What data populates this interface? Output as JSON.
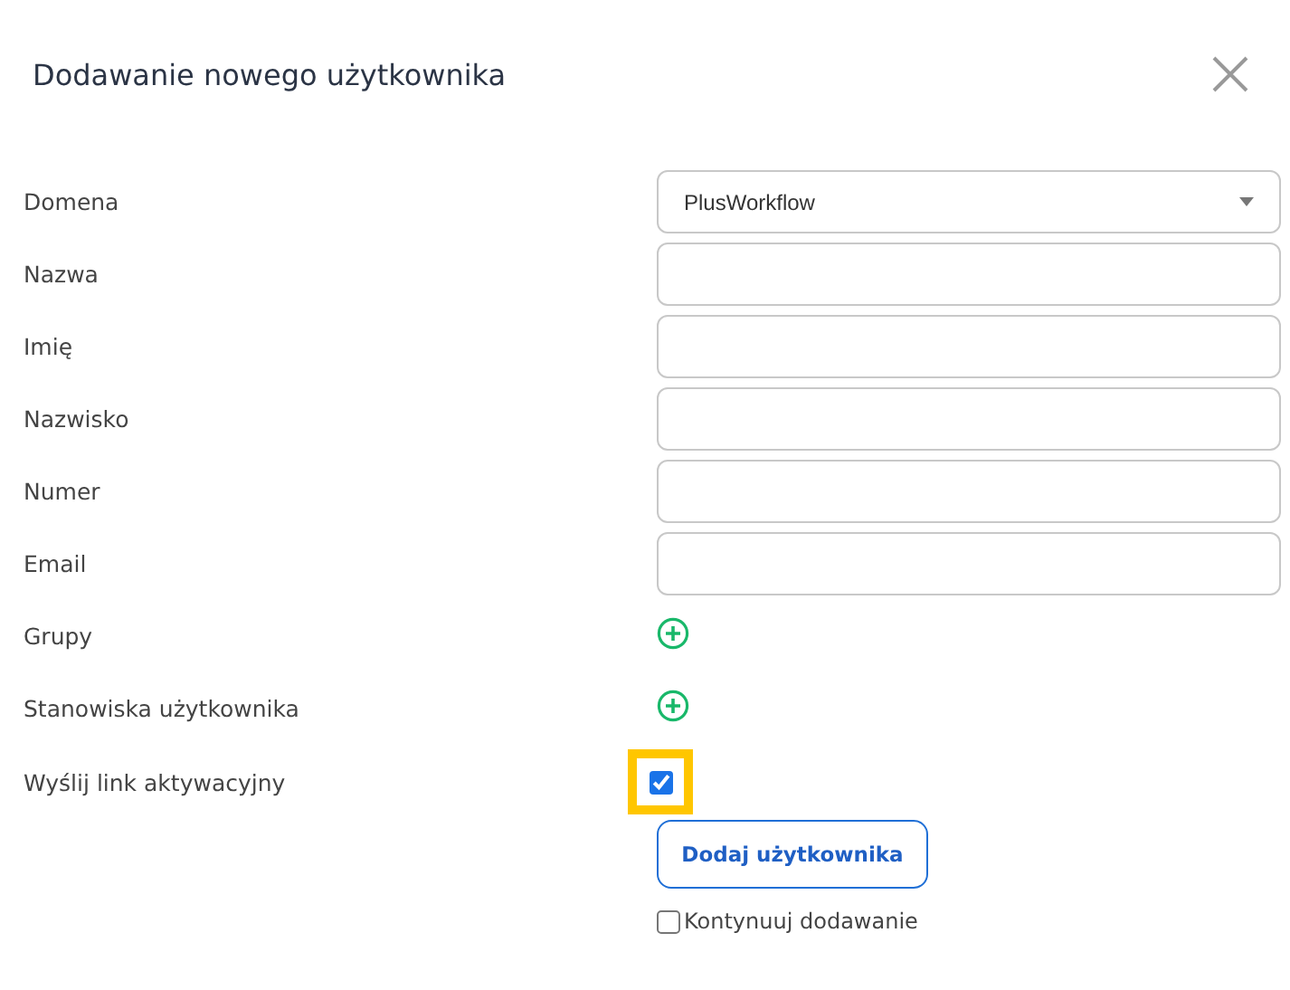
{
  "dialog": {
    "title": "Dodawanie nowego użytkownika"
  },
  "fields": [
    {
      "kind": "select",
      "label": "Domena",
      "value": "PlusWorkflow"
    },
    {
      "kind": "text",
      "label": "Nazwa"
    },
    {
      "kind": "text",
      "label": "Imię"
    },
    {
      "kind": "text",
      "label": "Nazwisko"
    },
    {
      "kind": "text",
      "label": "Numer"
    },
    {
      "kind": "text",
      "label": "Email"
    },
    {
      "kind": "add",
      "label": "Grupy"
    },
    {
      "kind": "add",
      "label": "Stanowiska użytkownika"
    },
    {
      "kind": "checkbox",
      "label": "Wyślij link aktywacyjny",
      "checked": true,
      "highlighted": true
    }
  ],
  "submit_button": "Dodaj użytkownika",
  "continue_option": {
    "label": "Kontynuuj dodawanie",
    "checked": false
  }
}
